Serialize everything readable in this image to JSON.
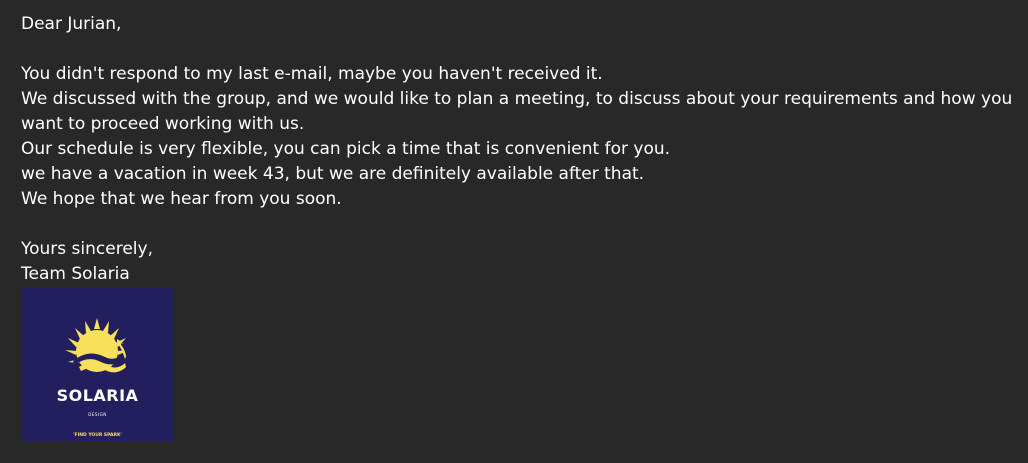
{
  "email": {
    "greeting": "Dear Jurian,",
    "paragraph": [
      "You didn't respond to my last e-mail, maybe you haven't received it.",
      "We discussed with the group, and we would like to plan a meeting, to discuss about your requirements and how you want to proceed working with us.",
      "Our schedule is very flexible, you can pick a time that is convenient for you.",
      "we have a vacation in week 43, but we are definitely available after that.",
      "We hope that we hear from you soon."
    ],
    "closing": "Yours sincerely,",
    "signature": "Team Solaria"
  },
  "logo": {
    "name": "SOLARIA",
    "subtitle": "DESIGN",
    "tagline": "'FIND YOUR SPARK'",
    "colors": {
      "background": "#231f5e",
      "sun": "#f7e15a",
      "text": "#ffffff"
    }
  },
  "colors": {
    "page_background": "#282828",
    "text": "#ffffff"
  }
}
